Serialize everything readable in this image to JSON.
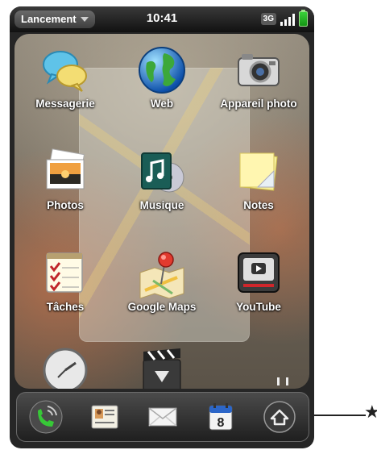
{
  "status_bar": {
    "menu_label": "Lancement",
    "time": "10:41",
    "network": "3G"
  },
  "apps": [
    {
      "label": "Messagerie",
      "icon": "speech-bubbles-icon"
    },
    {
      "label": "Web",
      "icon": "globe-icon"
    },
    {
      "label": "Appareil photo",
      "icon": "camera-icon"
    },
    {
      "label": "Photos",
      "icon": "photos-icon"
    },
    {
      "label": "Musique",
      "icon": "music-icon"
    },
    {
      "label": "Notes",
      "icon": "sticky-note-icon"
    },
    {
      "label": "Tâches",
      "icon": "checklist-icon"
    },
    {
      "label": "Google Maps",
      "icon": "map-pin-icon"
    },
    {
      "label": "YouTube",
      "icon": "tv-play-icon"
    },
    {
      "label": "",
      "icon": "clock-icon"
    },
    {
      "label": "",
      "icon": "clapperboard-icon"
    }
  ],
  "dock": [
    {
      "icon": "phone-icon"
    },
    {
      "icon": "contacts-icon"
    },
    {
      "icon": "email-icon"
    },
    {
      "icon": "calendar-icon",
      "day": "8"
    },
    {
      "icon": "launcher-up-arrow-icon"
    }
  ],
  "callout_symbol": "★",
  "colors": {
    "status_bar": "#1a1a1a",
    "battery": "#2ec52e",
    "dock": "#2a2a2a"
  }
}
